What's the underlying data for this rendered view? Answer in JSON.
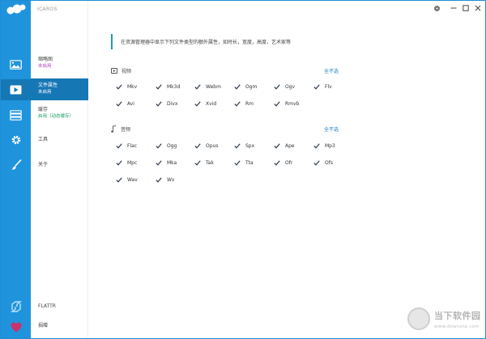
{
  "app": {
    "title": "ICAROS"
  },
  "nav": {
    "items": [
      {
        "label": "缩略图",
        "status": "未启用",
        "status_color": "purple"
      },
      {
        "label": "文件属性",
        "status": "未启用",
        "status_color": "purple",
        "active": true
      },
      {
        "label": "缓存",
        "status": "启用（动态缓存）",
        "status_color": "green"
      },
      {
        "label": "工具",
        "status": ""
      },
      {
        "label": "关于",
        "status": ""
      }
    ],
    "bottom": {
      "flattr": "FLATTR",
      "donate": "捐赠"
    }
  },
  "main": {
    "description": "在资源管理器中显示下列文件类型的额外属性，如时长，宽度，高度，艺术家等",
    "video": {
      "label": "视频",
      "deselect_label": "全不选",
      "options": [
        "Mkv",
        "Mk3d",
        "Webm",
        "Ogm",
        "Ogv",
        "Flv",
        "Avi",
        "Divx",
        "Xvid",
        "Rm",
        "Rmvb"
      ]
    },
    "audio": {
      "label": "音频",
      "deselect_label": "全不选",
      "options": [
        "Flac",
        "Ogg",
        "Opus",
        "Spx",
        "Ape",
        "Mp3",
        "Mpc",
        "Mka",
        "Tak",
        "Tta",
        "Ofr",
        "Ofs",
        "Wav",
        "Wv"
      ]
    }
  },
  "watermark": {
    "main": "当下软件园",
    "sub": "www.downxia.com"
  },
  "colors": {
    "rail": "#1f94dc",
    "active": "#1677b5",
    "link": "#1f7fc0",
    "accent_bar": "#1f9bb0"
  }
}
